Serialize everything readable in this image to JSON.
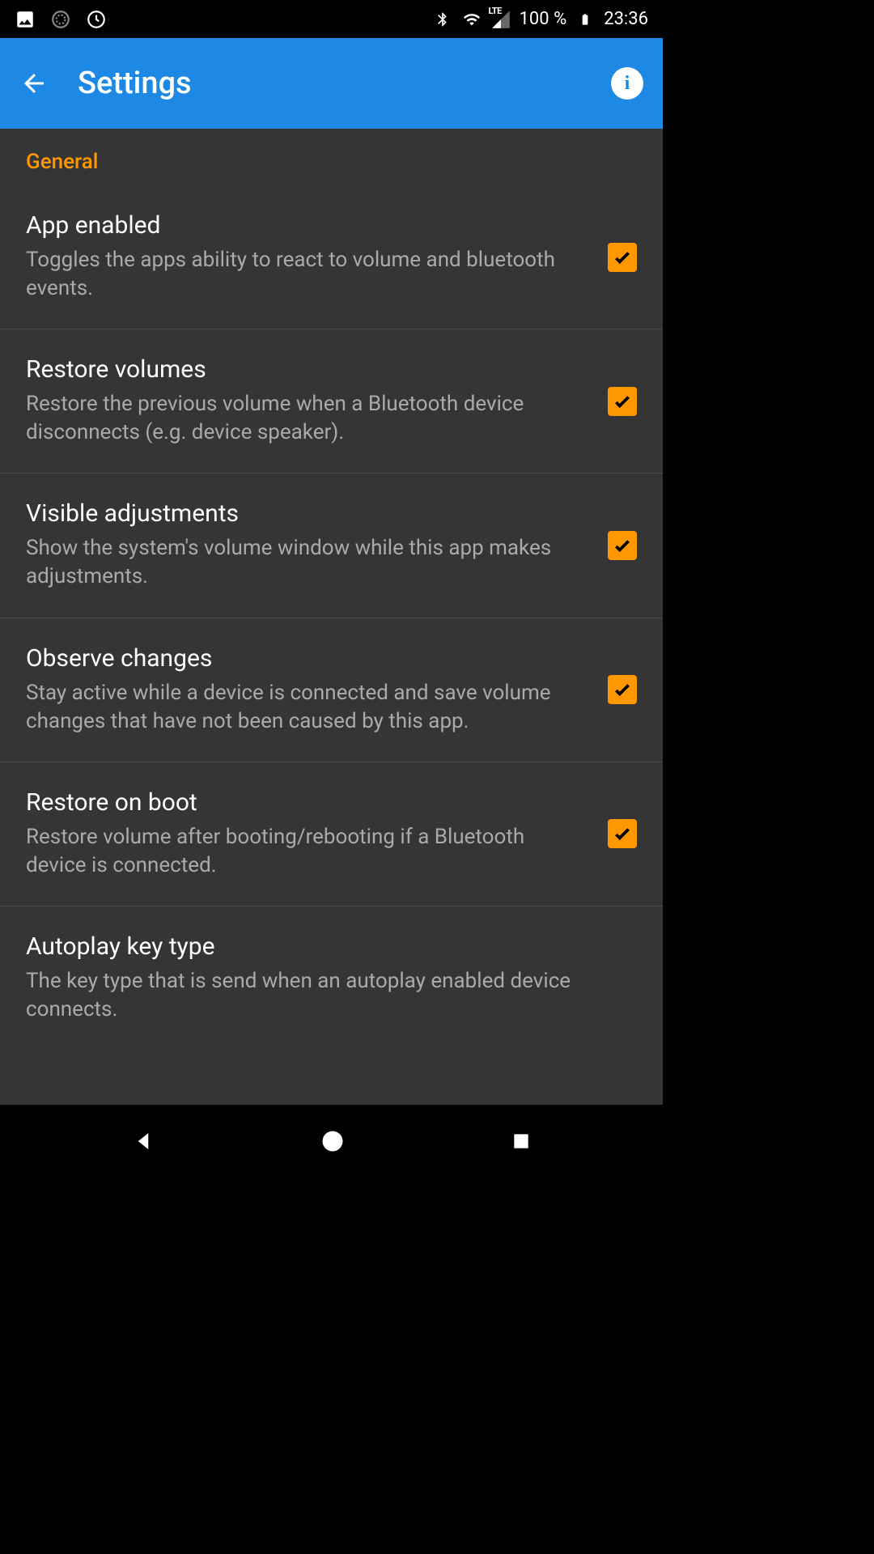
{
  "statusBar": {
    "battery": "100 %",
    "time": "23:36"
  },
  "appBar": {
    "title": "Settings"
  },
  "sectionHeader": "General",
  "settings": [
    {
      "title": "App enabled",
      "desc": "Toggles the apps ability to react to volume and bluetooth events.",
      "checked": true
    },
    {
      "title": "Restore volumes",
      "desc": "Restore the previous volume when a Bluetooth device disconnects (e.g. device speaker).",
      "checked": true
    },
    {
      "title": "Visible adjustments",
      "desc": "Show the system's volume window while this app makes adjustments.",
      "checked": true
    },
    {
      "title": "Observe changes",
      "desc": "Stay active while a device is connected and save volume changes that have not been caused by this app.",
      "checked": true
    },
    {
      "title": "Restore on boot",
      "desc": "Restore volume after booting/rebooting if a Bluetooth device is connected.",
      "checked": true
    },
    {
      "title": "Autoplay key type",
      "desc": "The key type that is send when an autoplay enabled device connects.",
      "checked": false
    }
  ]
}
